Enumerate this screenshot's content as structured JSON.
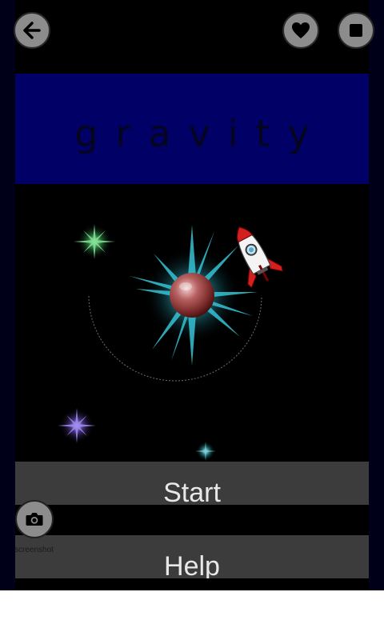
{
  "title": "gravity",
  "top_bar": {
    "back": "arrow-left-icon",
    "favorite": "heart-icon",
    "stop": "stop-icon"
  },
  "menu": {
    "start_label": "Start",
    "help_label": "Help"
  },
  "screenshot": {
    "label": "screenshot",
    "icon": "camera-icon"
  },
  "colors": {
    "title_banner": "#000066",
    "button_bg": "#3c3c3c",
    "round_button": "#8c8c8c"
  }
}
